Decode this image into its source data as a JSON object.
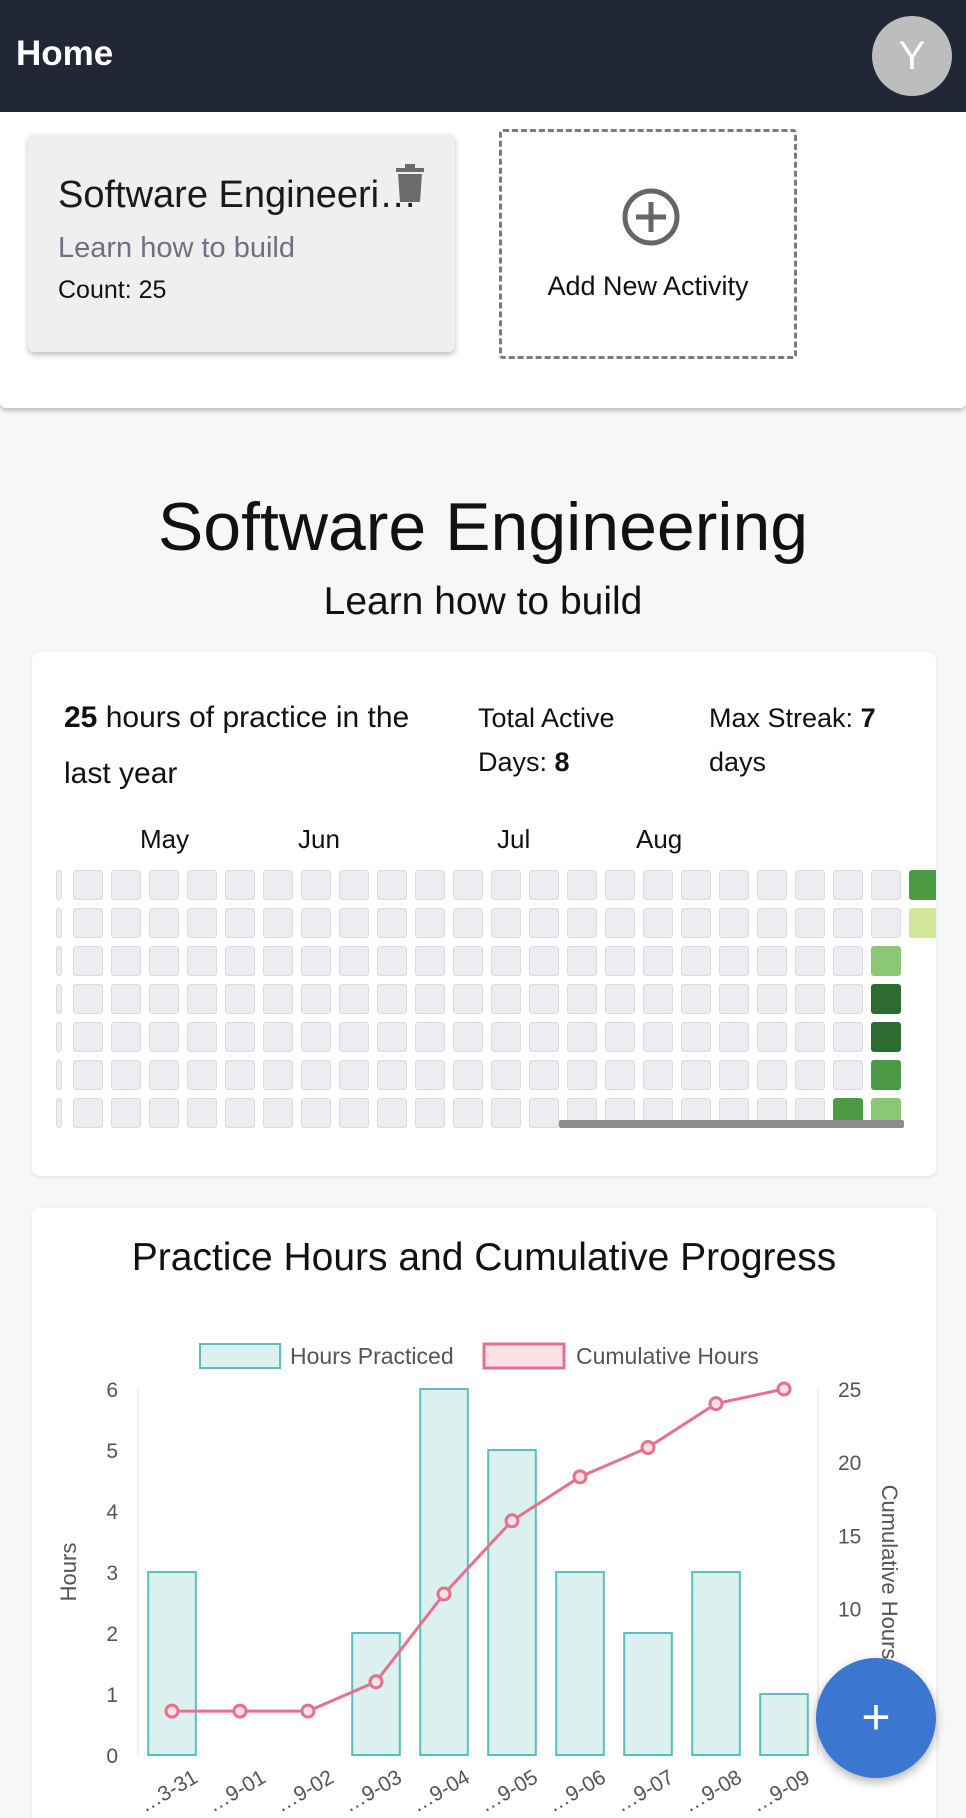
{
  "appbar": {
    "title": "Home",
    "avatar_letter": "Y"
  },
  "activities": [
    {
      "title": "Software Engineering",
      "description": "Learn how to build",
      "count_text": "Count: 25"
    }
  ],
  "add_activity": {
    "label": "Add New Activity"
  },
  "main": {
    "title": "Software Engineering",
    "subtitle": "Learn how to build"
  },
  "stats": {
    "hours_value": "25",
    "hours_text": "hours of practice in the last year",
    "active_days_label": "Total Active Days:",
    "active_days_value": "8",
    "streak_label": "Max Streak:",
    "streak_value": "7",
    "streak_unit": "days"
  },
  "heatmap": {
    "months": [
      "May",
      "Jun",
      "Jul",
      "Aug"
    ],
    "empty_color": "#ebedf0",
    "active_cells": [
      {
        "week": 22,
        "day": 0,
        "color": "#4d9a45"
      },
      {
        "week": 22,
        "day": 1,
        "color": "#d2e79a"
      },
      {
        "week": 21,
        "day": 2,
        "color": "#8cc776"
      },
      {
        "week": 21,
        "day": 3,
        "color": "#2e6b30"
      },
      {
        "week": 21,
        "day": 4,
        "color": "#2e6b30"
      },
      {
        "week": 21,
        "day": 5,
        "color": "#4d9a45"
      },
      {
        "week": 20,
        "day": 6,
        "color": "#4d9a45"
      },
      {
        "week": 21,
        "day": 6,
        "color": "#8cc776"
      }
    ]
  },
  "chart": {
    "title": "Practice Hours and Cumulative Progress",
    "legend": [
      "Hours Practiced",
      "Cumulative Hours"
    ],
    "left_axis_label": "Hours",
    "right_axis_label": "Cumulative Hours",
    "colors": {
      "bar_fill": "#ddf0f0",
      "bar_stroke": "#5cbfbf",
      "line": "#e5718c",
      "legend_line_fill": "#fbe1e7"
    }
  },
  "chart_data": {
    "type": "bar",
    "title": "Practice Hours and Cumulative Progress",
    "categories": [
      "…3-31",
      "…9-01",
      "…9-02",
      "…9-03",
      "…9-04",
      "…9-05",
      "…9-06",
      "…9-07",
      "…9-08",
      "…9-09"
    ],
    "series": [
      {
        "name": "Hours Practiced",
        "type": "bar",
        "axis": "left",
        "values": [
          3,
          0,
          0,
          2,
          6,
          5,
          3,
          2,
          3,
          1
        ]
      },
      {
        "name": "Cumulative Hours",
        "type": "line",
        "axis": "right",
        "values": [
          3,
          3,
          3,
          5,
          11,
          16,
          19,
          21,
          24,
          25
        ]
      }
    ],
    "ylabel": "Hours",
    "y2label": "Cumulative Hours",
    "ylim": [
      0,
      6
    ],
    "y2lim": [
      0,
      25
    ],
    "yticks": [
      0,
      1,
      2,
      3,
      4,
      5,
      6
    ],
    "y2ticks": [
      10,
      15,
      20,
      25
    ],
    "legend_position": "top"
  },
  "fab": {
    "label": "+"
  }
}
